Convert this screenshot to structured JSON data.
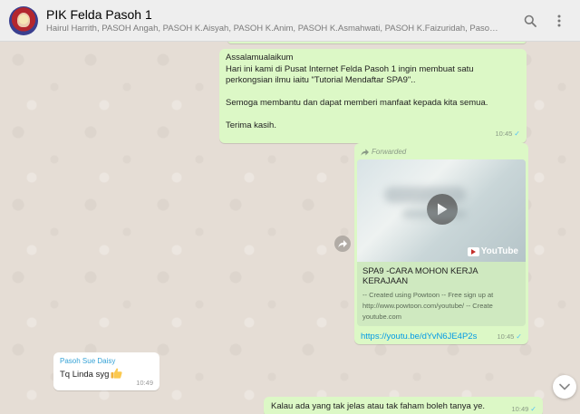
{
  "header": {
    "title": "PIK Felda Pasoh 1",
    "participants": "Hairul Harrith, PASOH Angah, PASOH K.Aisyah, PASOH K.Anim, PASOH K.Asmahwati, PASOH K.Faizuridah, Pasoh Sue Daisy, You"
  },
  "messages": {
    "m1": {
      "text": "Assalamualaikum\nHari ini kami di Pusat Internet Felda Pasoh 1 ingin membuat satu perkongsian ilmu iaitu \"Tutorial Mendaftar SPA9\"..\n\nSemoga membantu dan dapat memberi manfaat kepada kita semua.\n\nTerima kasih.",
      "time": "10:45"
    },
    "m2": {
      "forwarded_label": "Forwarded",
      "preview_title": "SPA9 -CARA MOHON KERJA KERAJAAN",
      "preview_description": "-- Created using Powtoon -- Free sign up at http://www.powtoon.com/youtube/ -- Create",
      "preview_site": "youtube.com",
      "brand": "YouTube",
      "link": "https://youtu.be/dYvN6JE4P2s",
      "time": "10:45"
    },
    "m3": {
      "sender": "Pasoh Sue Daisy",
      "text": "Tq Linda syg",
      "time": "10:49"
    },
    "m4": {
      "text": "Kalau ada yang tak jelas atau tak faham boleh tanya ye.",
      "time": "10:49"
    }
  },
  "icons": {
    "search": "search-icon",
    "menu": "menu-icon",
    "play": "play-icon",
    "share": "forward-share-icon",
    "scroll": "chevron-down-icon",
    "thumbs": "thumbs-up-emoji"
  },
  "colors": {
    "outgoing": "#dcf8c6",
    "incoming": "#ffffff",
    "link": "#039be5",
    "sender": "#35a2d6",
    "tick": "#4fc3f7"
  }
}
